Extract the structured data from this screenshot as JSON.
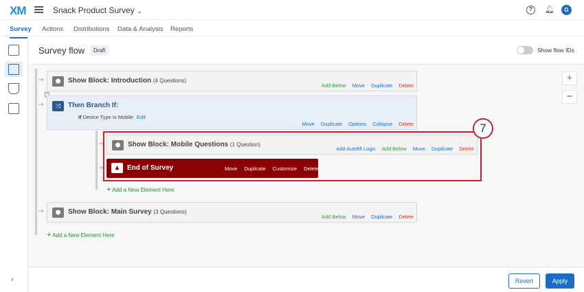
{
  "app": {
    "logo": "XM",
    "survey_title": "Snack Product Survey",
    "avatar": "G"
  },
  "tabs": [
    "Survey",
    "Actions",
    "Distributions",
    "Data & Analysis",
    "Reports"
  ],
  "header": {
    "title": "Survey flow",
    "badge": "Draft",
    "toggle_label": "Show flow IDs",
    "toggle_on": false
  },
  "flow": {
    "intro": {
      "title": "Show Block: Introduction",
      "count": "(4 Questions)",
      "actions": [
        "Add Below",
        "Move",
        "Duplicate",
        "Delete"
      ]
    },
    "branch": {
      "title": "Then Branch If:",
      "cond_if": "If",
      "condition": "Device Type Is Mobile",
      "edit": "Edit",
      "actions": [
        "Move",
        "Duplicate",
        "Options",
        "Collapse",
        "Delete"
      ]
    },
    "mobile": {
      "title": "Show Block: Mobile Questions",
      "count": "(1 Question)",
      "actions": [
        "Add Autofill Logic",
        "Add Below",
        "Move",
        "Duplicate",
        "Delete"
      ]
    },
    "end": {
      "title": "End of Survey",
      "actions": [
        "Move",
        "Duplicate",
        "Customize",
        "Delete"
      ]
    },
    "add_inner": "Add a New Element Here",
    "main": {
      "title": "Show Block: Main Survey",
      "count": "(3 Questions)",
      "actions": [
        "Add Below",
        "Move",
        "Duplicate",
        "Delete"
      ]
    },
    "add_outer": "Add a New Element Here"
  },
  "callout": "7",
  "footer": {
    "revert": "Revert",
    "apply": "Apply"
  },
  "colors": {
    "accent": "#1a6cc4",
    "end_block": "#8b0000",
    "highlight": "#c8202f"
  }
}
